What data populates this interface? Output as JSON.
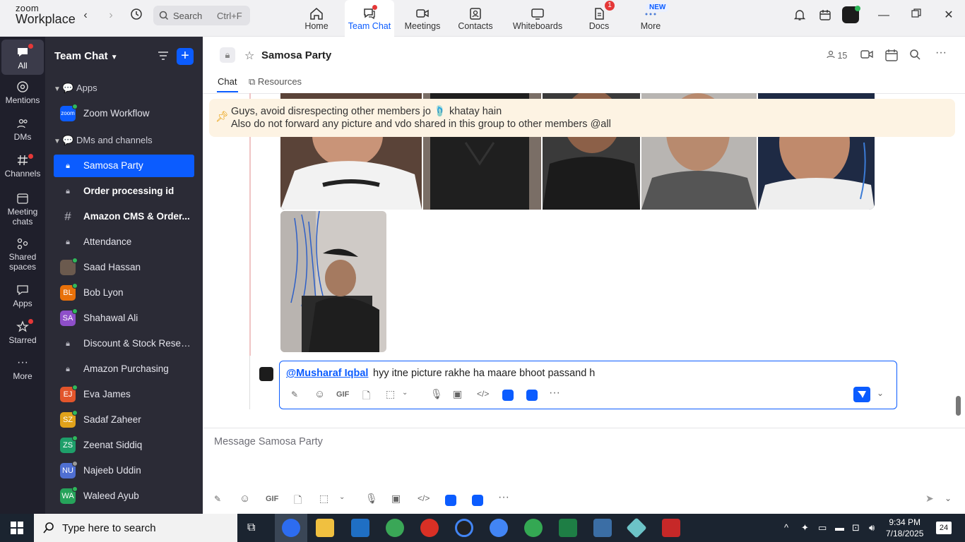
{
  "topbar": {
    "logo_line1": "zoom",
    "logo_line2": "Workplace",
    "search_label": "Search",
    "search_shortcut": "Ctrl+F",
    "nav": [
      {
        "label": "Home"
      },
      {
        "label": "Team Chat"
      },
      {
        "label": "Meetings"
      },
      {
        "label": "Contacts"
      },
      {
        "label": "Whiteboards"
      },
      {
        "label": "Docs",
        "badge": "1"
      },
      {
        "label": "More",
        "badge": "NEW"
      }
    ]
  },
  "rail": {
    "items": [
      {
        "label": "All"
      },
      {
        "label": "Mentions"
      },
      {
        "label": "DMs"
      },
      {
        "label": "Channels"
      },
      {
        "label": "Meeting chats"
      },
      {
        "label": "Shared spaces"
      },
      {
        "label": "Apps"
      },
      {
        "label": "Starred"
      },
      {
        "label": "More"
      }
    ]
  },
  "sidebar": {
    "title": "Team Chat",
    "sections": [
      {
        "label": "Apps"
      },
      {
        "label": "DMs and channels"
      }
    ],
    "apps": [
      {
        "label": "Zoom Workflow",
        "icon_text": "zoom"
      }
    ],
    "chats": [
      {
        "label": "Samosa Party",
        "initials": ""
      },
      {
        "label": "Order processing id",
        "initials": ""
      },
      {
        "label": "Amazon CMS & Order...",
        "initials": ""
      },
      {
        "label": "Attendance",
        "initials": ""
      },
      {
        "label": "Saad Hassan",
        "initials": ""
      },
      {
        "label": "Bob Lyon",
        "initials": "BL",
        "color": "#e8710a"
      },
      {
        "label": "Shahawal Ali",
        "initials": "SA",
        "color": "#8e4fc9"
      },
      {
        "label": "Discount & Stock Reser...",
        "initials": ""
      },
      {
        "label": "Amazon Purchasing",
        "initials": ""
      },
      {
        "label": "Eva James",
        "initials": "EJ",
        "color": "#e2552b"
      },
      {
        "label": "Sadaf Zaheer",
        "initials": "SZ",
        "color": "#e0a21b"
      },
      {
        "label": "Zeenat Siddiq",
        "initials": "ZS",
        "color": "#1e9f6a"
      },
      {
        "label": "Najeeb Uddin",
        "initials": "NU",
        "color": "#4f6fd1"
      },
      {
        "label": "Waleed Ayub",
        "initials": "WA",
        "color": "#26a35a"
      }
    ]
  },
  "main": {
    "channel_title": "Samosa Party",
    "member_count": "15",
    "tabs": [
      {
        "label": "Chat"
      },
      {
        "label": "Resources"
      }
    ],
    "pinned": {
      "line1": "Guys, avoid disrespecting other members jo 🩴 khatay hain",
      "line2": "Also do not forward any picture and vdo shared in this group to other members @all"
    },
    "edit": {
      "mention": "@Musharaf Iqbal",
      "text": "hyy itne picture rakhe ha maare bhoot passand h"
    },
    "composer_placeholder": "Message Samosa Party"
  },
  "taskbar": {
    "search_placeholder": "Type here to search",
    "time": "9:34 PM",
    "date": "7/18/2025",
    "notifications": "24"
  },
  "colors": {
    "accent": "#0b5cff",
    "rail_bg": "#1f1f2b",
    "sidebar_bg": "#2b2b36",
    "pinned_bg": "#fdf3e3"
  }
}
